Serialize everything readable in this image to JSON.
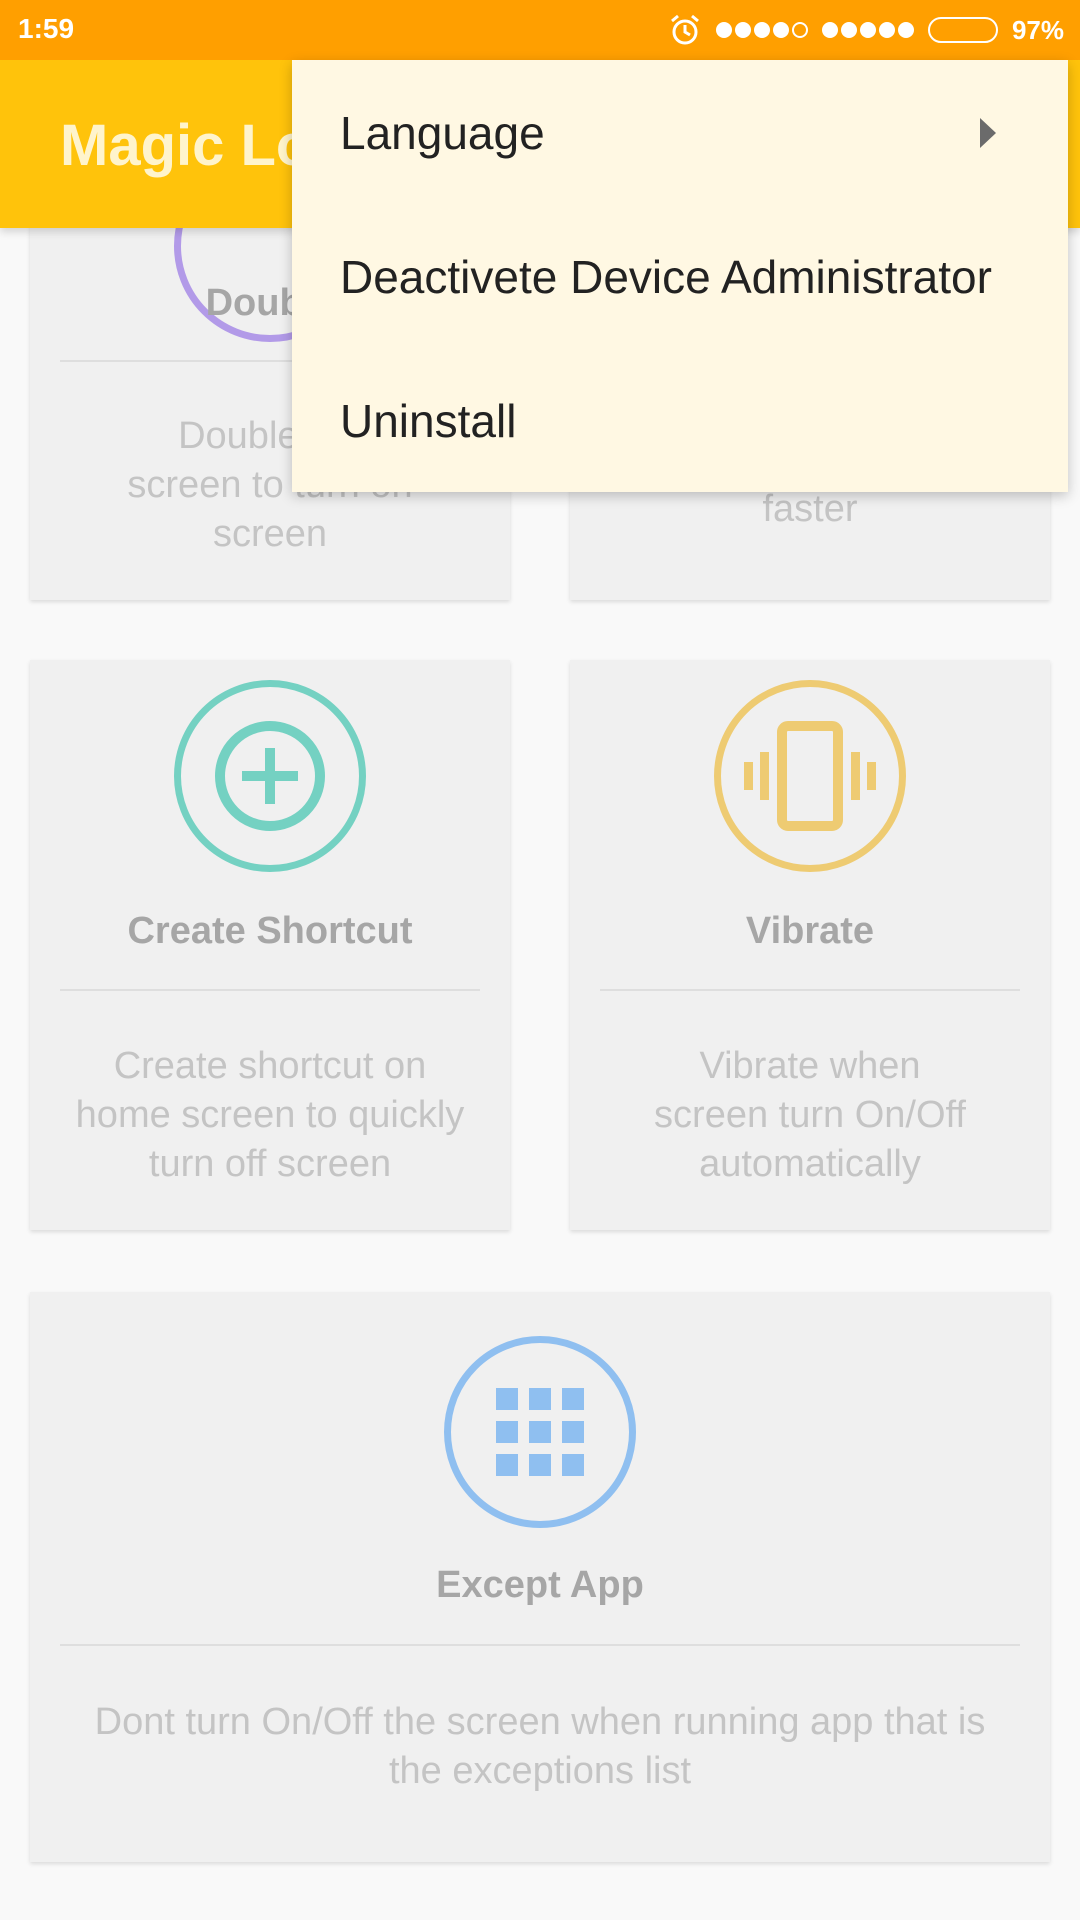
{
  "status_bar": {
    "time": "1:59",
    "battery": "97%"
  },
  "app_bar": {
    "title": "Magic Lo"
  },
  "menu": {
    "items": [
      {
        "label": "Language"
      },
      {
        "label": "Deactivete Device Administrator"
      },
      {
        "label": "Uninstall"
      }
    ]
  },
  "cards": {
    "double_tap": {
      "title": "Double",
      "desc": [
        "Double tap",
        "screen to turn on",
        "screen"
      ]
    },
    "faster": {
      "desc": "faster"
    },
    "create_shortcut": {
      "title": "Create Shortcut",
      "desc": [
        "Create shortcut on",
        "home screen to quickly",
        "turn off screen"
      ]
    },
    "vibrate": {
      "title": "Vibrate",
      "desc": [
        "Vibrate when",
        "screen turn On/Off",
        "automatically"
      ]
    },
    "except_app": {
      "title": "Except App",
      "desc": [
        "Dont turn On/Off the screen when running app that is",
        "the exceptions list"
      ]
    }
  },
  "colors": {
    "status_bar": "#ff9f00",
    "app_bar": "#ffc30b",
    "menu_bg": "#fff8e3",
    "shortcut_accent": "#74d1c2",
    "vibrate_accent": "#eecb72",
    "except_accent": "#8fbff0",
    "double_accent": "#b29ae8"
  },
  "icons": {
    "shortcut": "plus-circle-icon",
    "vibrate": "vibrate-phone-icon",
    "except": "app-grid-icon",
    "alarm": "alarm-icon"
  }
}
